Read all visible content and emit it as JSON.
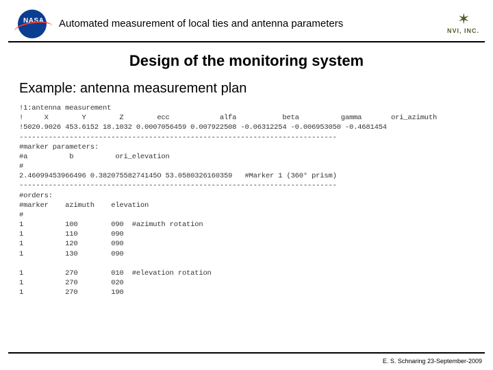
{
  "header": {
    "nasa_label": "NASA",
    "title": "Automated measurement of local ties and antenna parameters",
    "nvi_label": "NVI, INC.",
    "nvi_star": "✶"
  },
  "content": {
    "section_title": "Design of the monitoring system",
    "subtitle": "Example: antenna measurement plan",
    "code": "!1:antenna measurement\n!     X        Y        Z        ecc            alfa           beta          gamma       ori_azimuth\n!5020.9026 453.6152 18.1032 0.0007056459 0.007922508 -0.06312254 -0.006953050 -0.4681454\n----------------------------------------------------------------------------\n#marker parameters:\n#a          b          ori_elevation\n#\n2.46099453966496 0.38207558274145O 53.0580326160359   #Marker 1 (360° prism)\n----------------------------------------------------------------------------\n#orders:\n#marker    azimuth    elevation\n#\n1          100        090  #azimuth rotation\n1          110        090\n1          120        090\n1          130        090\n\n1          270        010  #elevation rotation\n1          270        020\n1          270        190"
  },
  "footer": {
    "text": "E. S. Schnaring 23-September-2009"
  }
}
